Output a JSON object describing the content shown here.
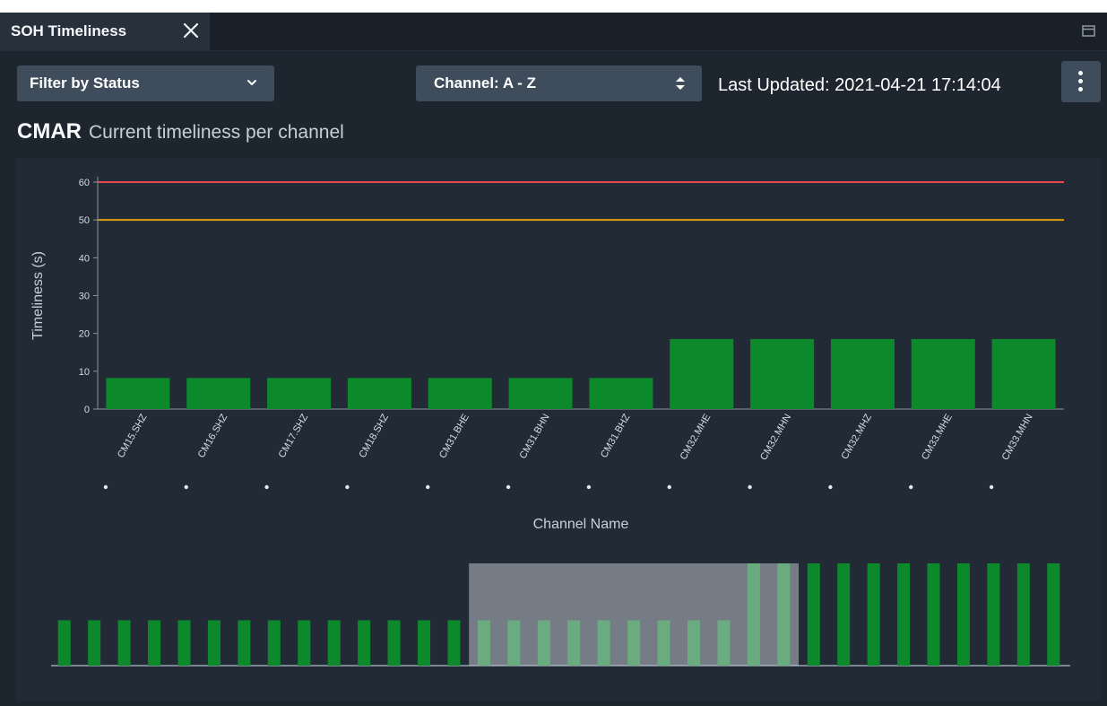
{
  "tab": {
    "title": "SOH Timeliness",
    "close_icon": "close-icon"
  },
  "toolbar": {
    "filter_label": "Filter by Status",
    "sort_label": "Channel: A - Z",
    "last_updated": "Last Updated: 2021-04-21 17:14:04",
    "menu_icon": "kebab-menu-icon"
  },
  "heading": {
    "station": "CMAR",
    "subtitle": "Current timeliness per channel"
  },
  "colors": {
    "bar": "#0c8a2b",
    "critical_line": "#e8474d",
    "warning_line": "#d99d12",
    "panel": "#222b35",
    "axis": "#8a95a1"
  },
  "chart_data": {
    "type": "bar",
    "categories": [
      "CM15.SHZ",
      "CM16.SHZ",
      "CM17.SHZ",
      "CM18.SHZ",
      "CM31.BHE",
      "CM31.BHN",
      "CM31.BHZ",
      "CM32.MHE",
      "CM32.MHN",
      "CM32.MHZ",
      "CM33.MHE",
      "CM33.MHN"
    ],
    "values": [
      8.2,
      8.2,
      8.2,
      8.2,
      8.2,
      8.2,
      8.2,
      18.5,
      18.5,
      18.5,
      18.5,
      18.5
    ],
    "xlabel": "Channel Name",
    "ylabel": "Timeliness (s)",
    "ylim": [
      0,
      60
    ],
    "yticks": [
      0,
      10,
      20,
      30,
      40,
      50,
      60
    ],
    "thresholds": [
      {
        "name": "critical",
        "value": 60
      },
      {
        "name": "warning",
        "value": 50
      }
    ],
    "grid": false
  },
  "overview": {
    "short_value": 8.2,
    "tall_value": 18.5,
    "short_count": 23,
    "tall_count": 11,
    "brush_range": [
      14,
      25
    ]
  }
}
